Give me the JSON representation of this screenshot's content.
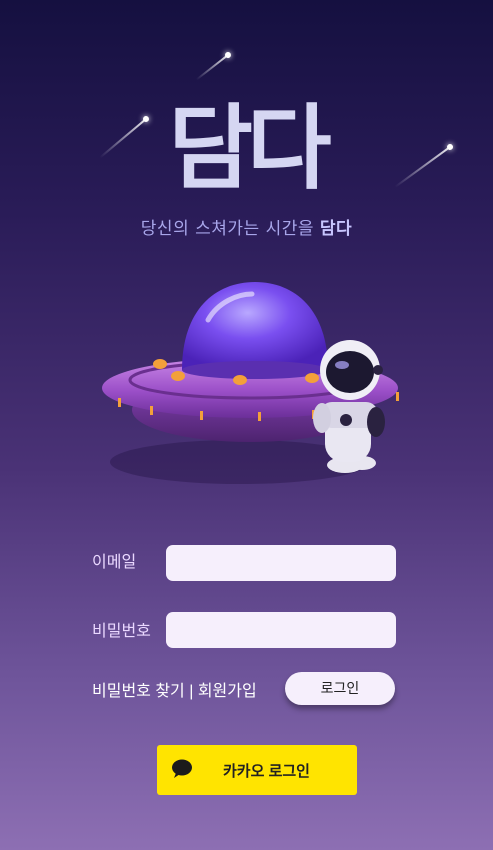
{
  "app": {
    "logo_text": "담다",
    "tagline_prefix": "당신의 스쳐가는 시간을",
    "tagline_emphasis": "담다"
  },
  "form": {
    "email_label": "이메일",
    "email_value": "",
    "password_label": "비밀번호",
    "password_value": ""
  },
  "links": {
    "find_password": "비밀번호 찾기",
    "separator": "|",
    "signup": "회원가입"
  },
  "buttons": {
    "login": "로그인",
    "kakao_login": "카카오 로그인"
  },
  "icons": {
    "kakao": "chat-bubble-icon",
    "illustration": "ufo-astronaut-illustration"
  },
  "colors": {
    "kakao_yellow": "#FFE400",
    "logo": "#D5D6F2",
    "tagline": "#A8A6EA"
  }
}
